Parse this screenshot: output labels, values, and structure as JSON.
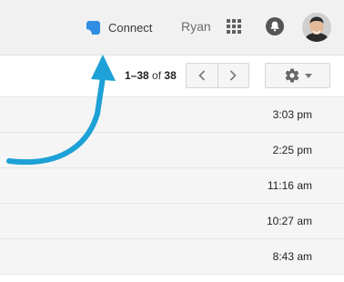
{
  "header": {
    "connect_label": "Connect",
    "user_name": "Ryan"
  },
  "toolbar": {
    "range": "1–38",
    "of_word": "of",
    "total": "38"
  },
  "messages": [
    {
      "time": "3:03 pm"
    },
    {
      "time": "2:25 pm"
    },
    {
      "time": "11:16 am"
    },
    {
      "time": "10:27 am"
    },
    {
      "time": "8:43 am"
    }
  ],
  "colors": {
    "accent_arrow": "#1da1d6",
    "connect_logo": "#2f8de4",
    "header_bg": "#f1f1f1",
    "row_bg": "#f5f5f5"
  }
}
